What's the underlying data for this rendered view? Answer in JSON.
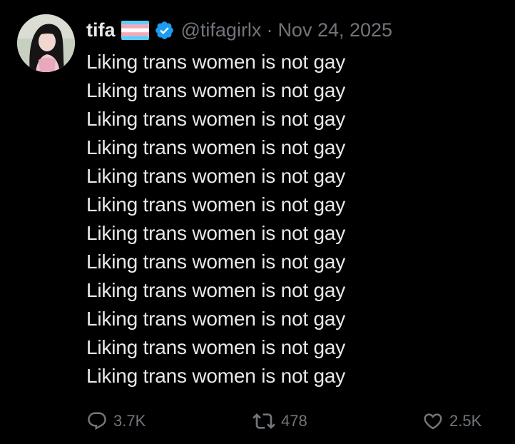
{
  "author": {
    "display_name": "tifa",
    "handle": "@tifagirlx",
    "flag_icon": "trans-flag-icon",
    "verified_icon": "verified-badge-icon",
    "avatar_icon": "avatar",
    "colors": {
      "verified": "#1d9bf0",
      "flag_blue": "#5bcefa",
      "flag_pink": "#f5a9b8",
      "flag_white": "#ffffff"
    }
  },
  "meta": {
    "separator": "·",
    "date": "Nov 24, 2025"
  },
  "body": {
    "lines": [
      "Liking trans women is not gay",
      "Liking trans women is not gay",
      "Liking trans women is not gay",
      "Liking trans women is not gay",
      "Liking trans women is not gay",
      "Liking trans women is not gay",
      "Liking trans women is not gay",
      "Liking trans women is not gay",
      "Liking trans women is not gay",
      "Liking trans women is not gay",
      "Liking trans women is not gay",
      "Liking trans women is not gay"
    ]
  },
  "actions": {
    "reply": {
      "icon": "reply-icon",
      "count": "3.7K"
    },
    "repost": {
      "icon": "repost-icon",
      "count": "478"
    },
    "like": {
      "icon": "heart-icon",
      "count": "2.5K"
    }
  },
  "theme": {
    "background": "#000000",
    "text": "#e7e9ea",
    "muted": "#71767b"
  }
}
